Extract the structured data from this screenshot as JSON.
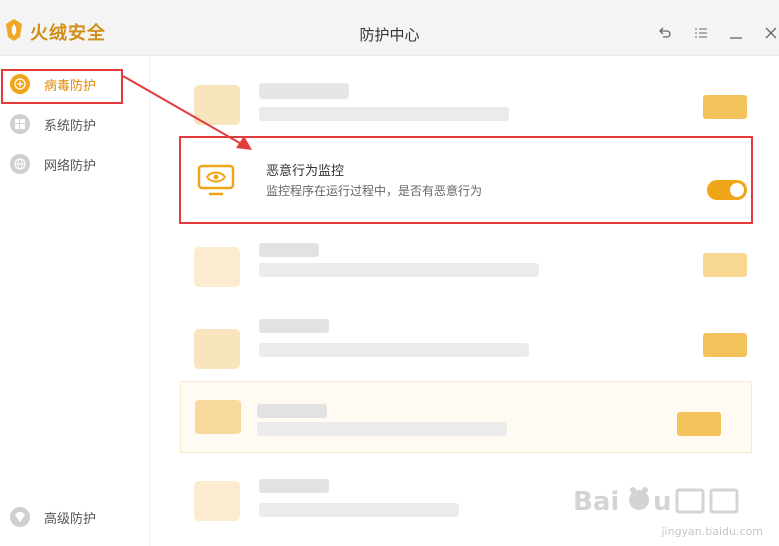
{
  "app": {
    "brand": "火绒安全",
    "window_title": "防护中心"
  },
  "window_controls": [
    {
      "name": "back-icon"
    },
    {
      "name": "menu-icon"
    },
    {
      "name": "minimize-icon"
    },
    {
      "name": "close-icon"
    }
  ],
  "sidebar": {
    "items": [
      {
        "label": "病毒防护",
        "icon": "plus-circle-icon",
        "active": true
      },
      {
        "label": "系统防护",
        "icon": "windows-icon",
        "active": false
      },
      {
        "label": "网络防护",
        "icon": "globe-icon",
        "active": false
      },
      {
        "label": "高级防护",
        "icon": "diamond-icon",
        "active": false
      }
    ]
  },
  "feature": {
    "title": "恶意行为监控",
    "description": "监控程序在运行过程中，是否有恶意行为",
    "enabled": true
  },
  "watermark": {
    "text": "jingyan.baidu.com"
  },
  "colors": {
    "accent": "#f0a417",
    "active_text": "#e28a00",
    "annotation": "#e23c3c"
  }
}
